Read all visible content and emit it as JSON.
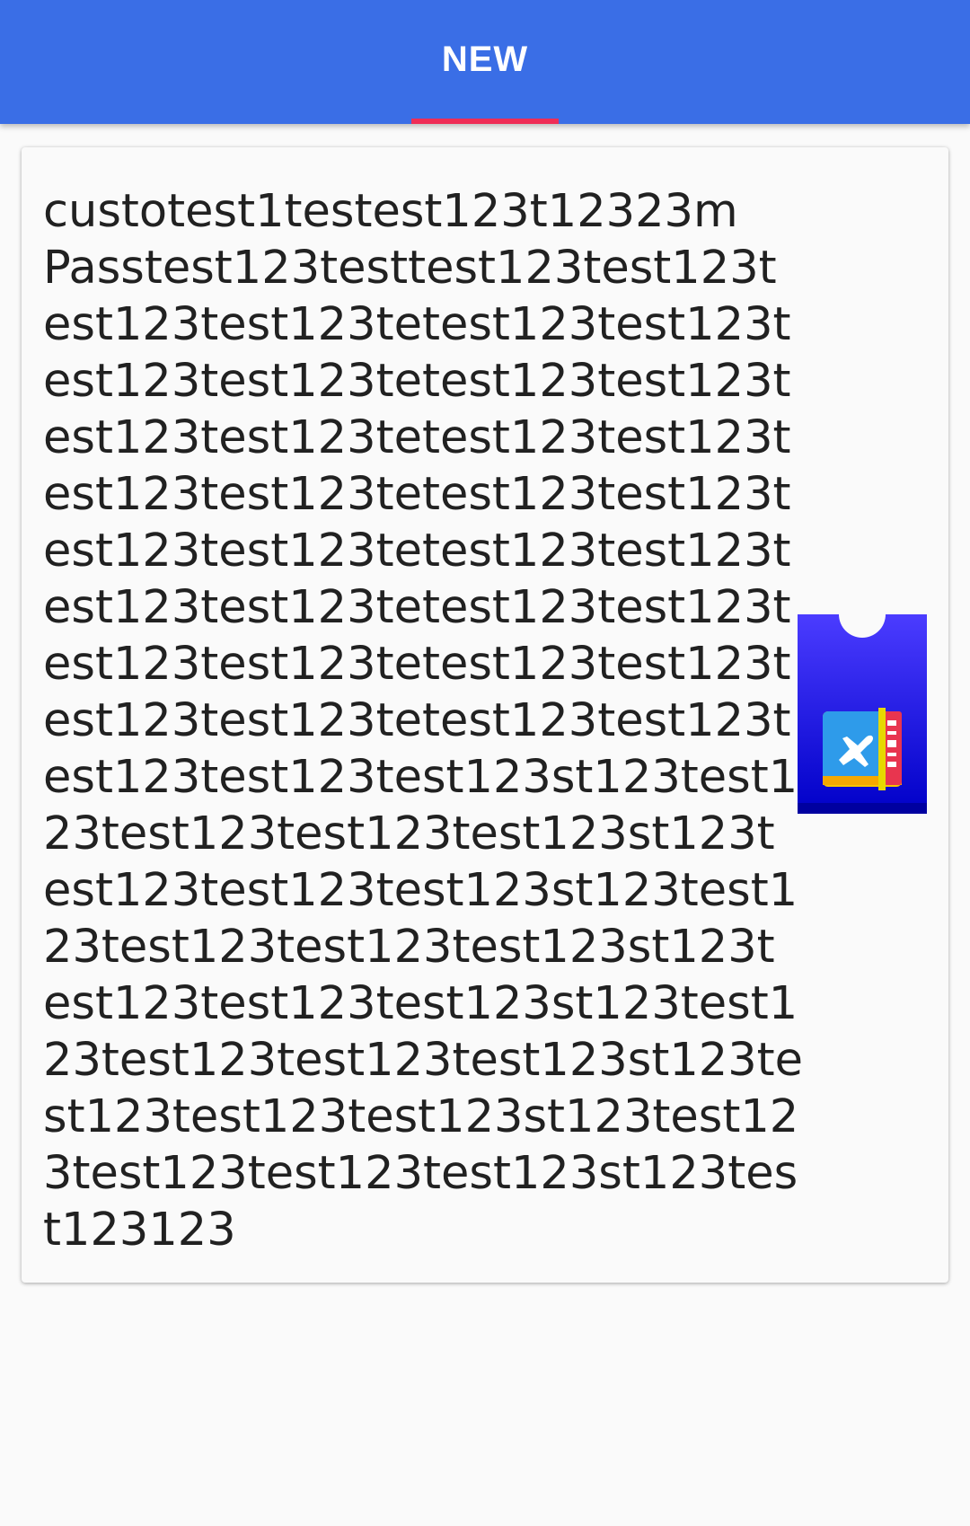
{
  "tabs": [
    {
      "label": "NEW",
      "selected": true
    }
  ],
  "card": {
    "text": "custotest1testest123t12323m\nPasstest123testtest123test123t\nest123test123tetest123test123t\nest123test123tetest123test123t\nest123test123tetest123test123t\nest123test123tetest123test123t\nest123test123tetest123test123t\nest123test123tetest123test123t\nest123test123tetest123test123t\nest123test123tetest123test123t\nest123test123test123st123test1\n23test123test123test123st123t\nest123test123test123st123test1\n23test123test123test123st123t\nest123test123test123st123test1\n23test123test123test123st123te\nst123test123test123st123test12\n3test123test123test123st123tes\nt123123"
  },
  "colors": {
    "appbar": "#3a6ee6",
    "indicator": "#ef2d56",
    "ticket_top": "#4b3cff",
    "ticket_bottom": "#0000c8"
  },
  "icons": {
    "pass_image": "boarding-pass-ticket-icon"
  }
}
